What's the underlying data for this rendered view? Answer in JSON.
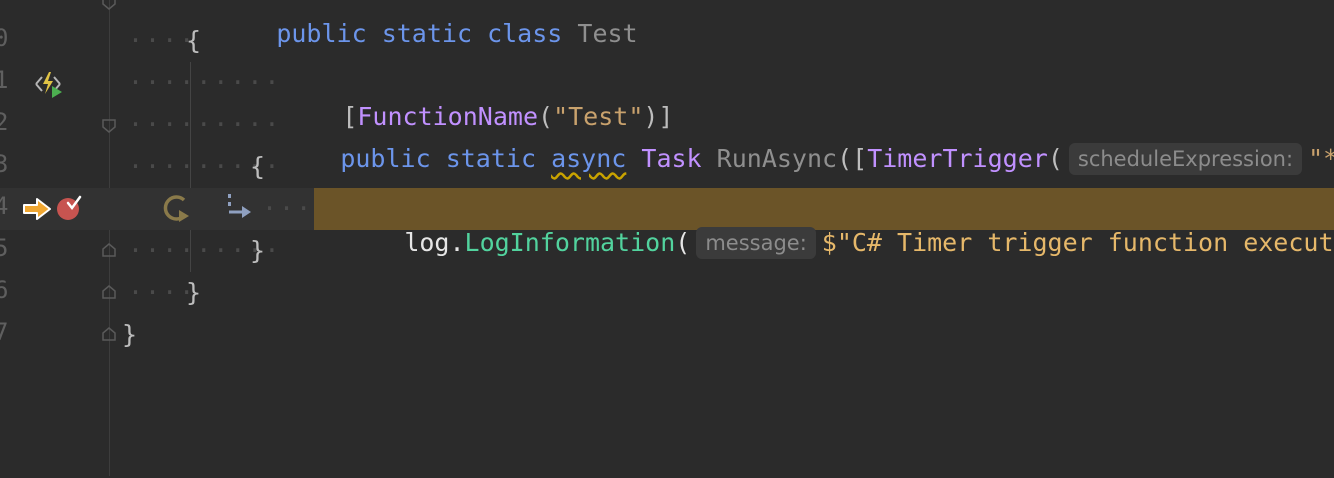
{
  "editor": {
    "line_numbers": [
      "0",
      "1",
      "2",
      "3",
      "4",
      "5",
      "6",
      "7"
    ],
    "line9": {
      "kw1": "public",
      "kw2": "static",
      "kw3": "class",
      "name": "Test"
    },
    "line10": {
      "brace": "{"
    },
    "line11": {
      "open": "[",
      "attr": "FunctionName",
      "paren_open": "(",
      "str": "\"Test\"",
      "close": ")]"
    },
    "line12": {
      "kw1": "public",
      "kw2": "static",
      "kw3": "async",
      "type": "Task",
      "method": "RunAsync",
      "paren": "([",
      "attr": "TimerTrigger",
      "paren2": "(",
      "hint": "scheduleExpression:",
      "str": "\"*/"
    },
    "line13": {
      "brace": "{"
    },
    "line14": {
      "obj": "log",
      "dot": ".",
      "method": "LogInformation",
      "paren": "(",
      "hint": "message:",
      "str": "$\"C# Timer trigger function executed"
    },
    "line15": {
      "brace": "}"
    },
    "line16": {
      "brace": "}"
    },
    "line17": {
      "brace": "}"
    }
  },
  "colors": {
    "background": "#2b2b2b",
    "keyword": "#6c95eb",
    "type": "#c191ff",
    "method": "#39cc9b",
    "string": "#c9a26d",
    "execution_highlight": "#6b5428",
    "execution_arrow": "#f0a732",
    "breakpoint": "#c75450"
  },
  "icons": {
    "line11": "azure-function-run-icon",
    "line14_arrow": "execution-point-arrow-icon",
    "line14_breakpoint": "breakpoint-checked-icon",
    "line14_step": "step-over-icon",
    "line14_jump": "jump-to-statement-icon"
  }
}
